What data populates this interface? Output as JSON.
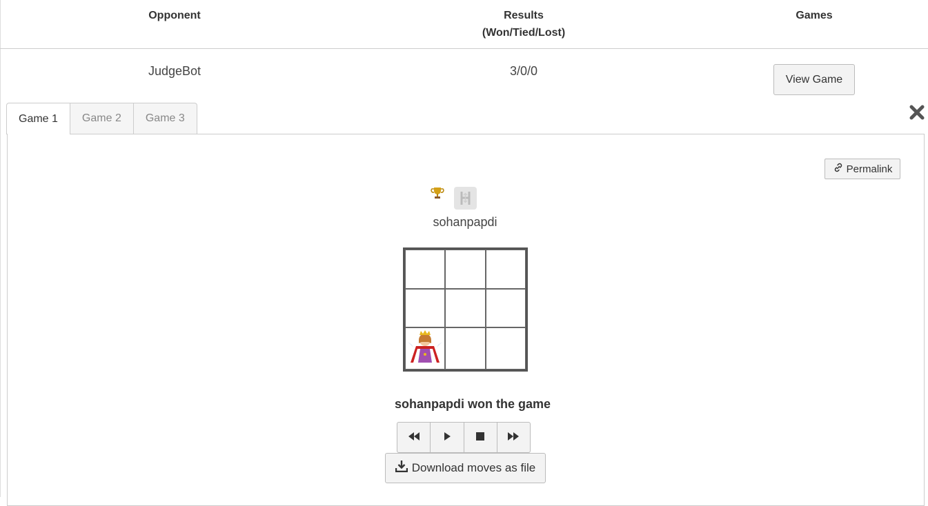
{
  "table": {
    "headers": {
      "opponent": "Opponent",
      "results_line1": "Results",
      "results_line2": "(Won/Tied/Lost)",
      "games": "Games"
    },
    "row": {
      "opponent": "JudgeBot",
      "results": "3/0/0",
      "view_button": "View Game"
    }
  },
  "tabs": [
    {
      "label": "Game 1",
      "active": true
    },
    {
      "label": "Game 2",
      "active": false
    },
    {
      "label": "Game 3",
      "active": false
    }
  ],
  "game": {
    "permalink_label": "Permalink",
    "player_name": "sohanpapdi",
    "result_text": "sohanpapdi won the game",
    "board": [
      [
        "",
        "",
        ""
      ],
      [
        "",
        "",
        ""
      ],
      [
        "queen",
        "",
        ""
      ]
    ],
    "download_label": "Download moves as file",
    "controls": [
      "rewind-icon",
      "play-icon",
      "stop-icon",
      "fast-forward-icon"
    ]
  },
  "icons": {
    "close": "close-icon",
    "trophy": "trophy-icon",
    "bot": "bot-icon",
    "link": "link-icon",
    "download": "download-icon"
  },
  "colors": {
    "border": "#cccccc",
    "button_bg": "#f3f3f3",
    "text": "#333333",
    "board_line": "#555555"
  }
}
